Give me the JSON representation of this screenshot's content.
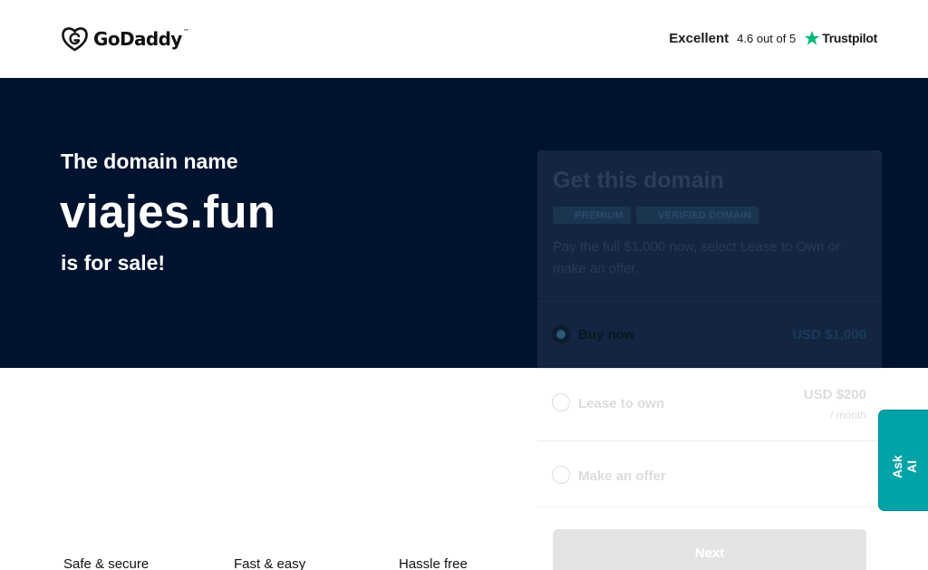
{
  "header": {
    "brand": "GoDaddy",
    "brand_tm": "™",
    "trust": {
      "rating": "Excellent",
      "score": "4.6 out of 5",
      "provider": "Trustpilot",
      "star_color": "#00b67a"
    }
  },
  "hero": {
    "kicker": "The domain name",
    "domain": "viajes.fun",
    "suffix": "is for sale!",
    "background": "#00132e"
  },
  "card": {
    "title": "Get this domain",
    "badges": [
      "PREMIUM",
      "VERIFIED DOMAIN"
    ],
    "description": "Pay the full $1,000 now, select Lease to Own or make an offer.",
    "options": [
      {
        "label": "Buy now",
        "price": "USD $1,000",
        "selected": true
      },
      {
        "label": "Lease to own",
        "price": "USD $200",
        "sub": "/ month",
        "selected": false
      },
      {
        "label": "Make an offer",
        "selected": false
      }
    ],
    "next_label": "Next"
  },
  "ask_ai": {
    "label": "Ask AI",
    "color": "#00a4a6"
  },
  "features": [
    "Safe & secure",
    "Fast & easy",
    "Hassle free"
  ]
}
